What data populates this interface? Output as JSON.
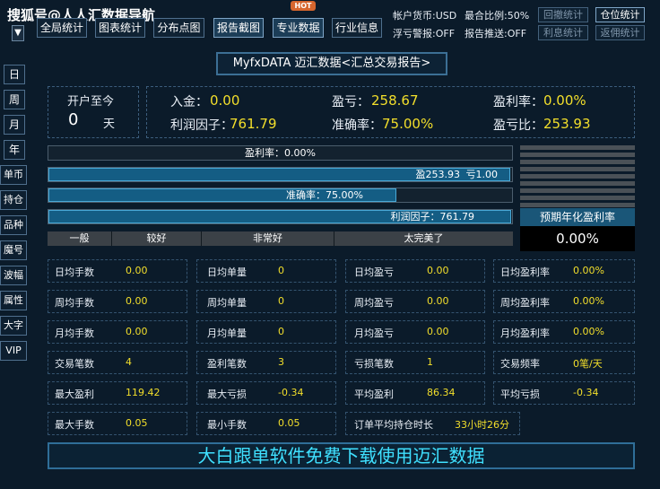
{
  "watermark": "搜狐号@人人汇数据导航",
  "dropdown_glyph": "▼",
  "toolbar": {
    "buttons": [
      "全局统计",
      "图表统计",
      "分布点图",
      "报告截图",
      "专业数据",
      "行业信息"
    ],
    "hot_badge": "HOT"
  },
  "account": {
    "currency": "帐户货币:USD",
    "dd_ratio": "最合比例:50%",
    "float_alert": "浮亏警报:OFF",
    "report_push": "报告推送:OFF"
  },
  "right_buttons": [
    "回撤统计",
    "仓位统计",
    "利息统计",
    "返佣统计"
  ],
  "sidebar": [
    "日",
    "周",
    "月",
    "年",
    "单币",
    "持仓",
    "品种",
    "魔号",
    "波幅",
    "属性",
    "大字",
    "VIP"
  ],
  "title": "MyfxDATA 迈汇数据<汇总交易报告>",
  "since_open": {
    "label": "开户至今",
    "value": "0",
    "unit": "天"
  },
  "summary": {
    "deposit_label": "入金：",
    "deposit_value": "0.00",
    "pnl_label": "盈亏：",
    "pnl_value": "258.67",
    "profit_rate_label": "盈利率：",
    "profit_rate_value": "0.00%",
    "profit_factor_label": "利润因子：",
    "profit_factor_value": "761.79",
    "accuracy_label": "准确率：",
    "accuracy_value": "75.00%",
    "pl_ratio_label": "盈亏比：",
    "pl_ratio_value": "253.93"
  },
  "bars": {
    "profit_rate": {
      "label": "盈利率：0.00%",
      "fill": 0.0
    },
    "pl_ratio": {
      "label_left": "盈253.93",
      "label_right": "亏1.00",
      "fill": 0.996
    },
    "accuracy": {
      "label": "准确率：75.00%",
      "fill": 0.75
    },
    "profit_factor": {
      "label": "利润因子：761.79",
      "fill": 0.999
    }
  },
  "scale_labels": [
    "一般",
    "较好",
    "非常好",
    "太完美了"
  ],
  "annual": {
    "label": "预期年化盈利率",
    "value": "0.00%"
  },
  "stats": [
    [
      {
        "k": "日均手数",
        "v": "0.00"
      },
      {
        "k": "日均单量",
        "v": "0"
      },
      {
        "k": "日均盈亏",
        "v": "0.00"
      },
      {
        "k": "日均盈利率",
        "v": "0.00%"
      }
    ],
    [
      {
        "k": "周均手数",
        "v": "0.00"
      },
      {
        "k": "周均单量",
        "v": "0"
      },
      {
        "k": "周均盈亏",
        "v": "0.00"
      },
      {
        "k": "周均盈利率",
        "v": "0.00%"
      }
    ],
    [
      {
        "k": "月均手数",
        "v": "0.00"
      },
      {
        "k": "月均单量",
        "v": "0"
      },
      {
        "k": "月均盈亏",
        "v": "0.00"
      },
      {
        "k": "月均盈利率",
        "v": "0.00%"
      }
    ],
    [
      {
        "k": "交易笔数",
        "v": "4"
      },
      {
        "k": "盈利笔数",
        "v": "3"
      },
      {
        "k": "亏损笔数",
        "v": "1"
      },
      {
        "k": "交易频率",
        "v": "0笔/天"
      }
    ],
    [
      {
        "k": "最大盈利",
        "v": "119.42"
      },
      {
        "k": "最大亏损",
        "v": "-0.34"
      },
      {
        "k": "平均盈利",
        "v": "86.34"
      },
      {
        "k": "平均亏损",
        "v": "-0.34"
      }
    ],
    [
      {
        "k": "最大手数",
        "v": "0.05"
      },
      {
        "k": "最小手数",
        "v": "0.05"
      },
      {
        "k": "订单平均持仓时长",
        "v": "33小时26分"
      }
    ]
  ],
  "footer": "大白跟单软件免费下载使用迈汇数据"
}
